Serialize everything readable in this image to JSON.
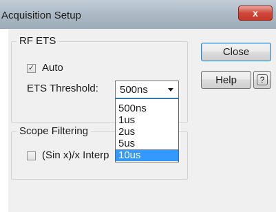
{
  "window": {
    "title": "Acquisition Setup",
    "close_glyph": "x"
  },
  "rf_ets": {
    "group_label": "RF ETS",
    "auto_label": "Auto",
    "auto_checked": true,
    "threshold_label": "ETS Threshold:",
    "threshold_value": "500ns"
  },
  "dropdown": {
    "options": [
      "500ns",
      "1us",
      "2us",
      "5us",
      "10us"
    ],
    "highlighted": "10us"
  },
  "scope_filtering": {
    "group_label": "Scope Filtering",
    "sinx_label": "(Sin x)/x Interp",
    "sinx_checked": false
  },
  "buttons": {
    "close_label": "Close",
    "help_label": "Help",
    "context_help_glyph": "?"
  },
  "colors": {
    "selection": "#3399ff",
    "title_close": "#c0392b"
  }
}
